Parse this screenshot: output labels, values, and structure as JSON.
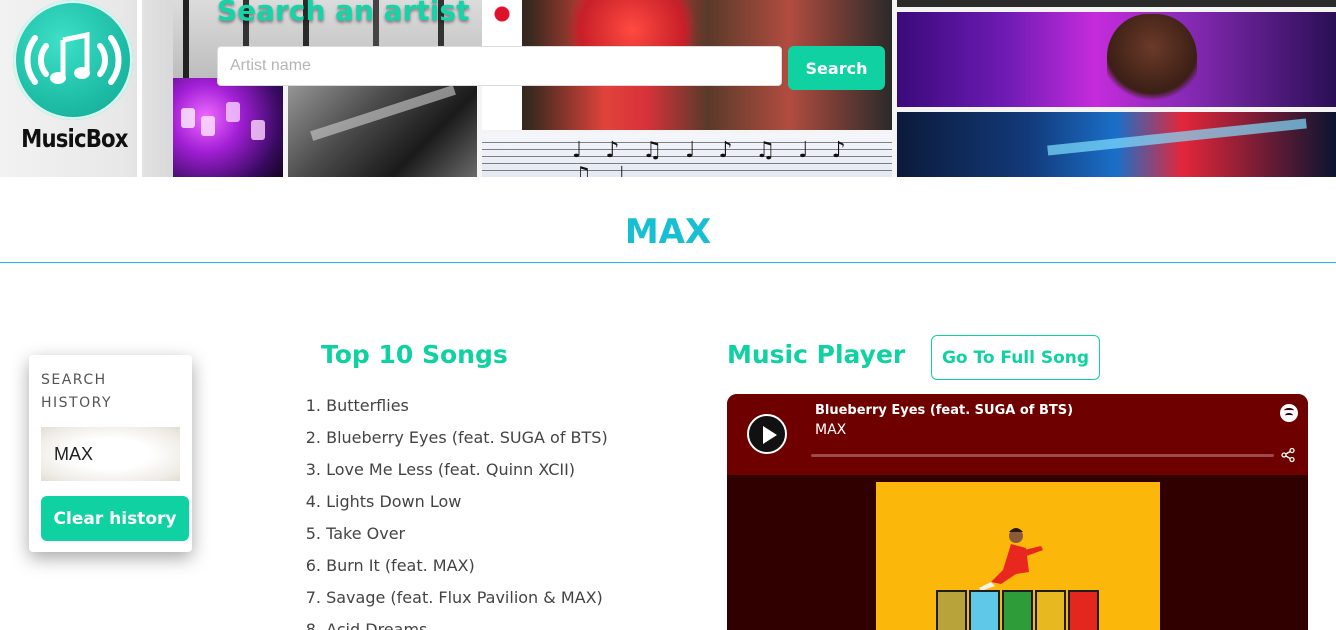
{
  "brand": {
    "name": "MusicBox",
    "accent_color": "#10d1a2",
    "title_color": "#17bfd2"
  },
  "header": {
    "search_title": "Search an artist",
    "search_placeholder": "Artist name",
    "search_value": "",
    "search_button_label": "Search"
  },
  "artist": {
    "name": "MAX"
  },
  "search_history": {
    "heading": "SEARCH HISTORY",
    "items": [
      "MAX"
    ],
    "clear_button_label": "Clear history"
  },
  "top_songs": {
    "heading": "Top 10 Songs",
    "songs": [
      "Butterflies",
      "Blueberry Eyes (feat. SUGA of BTS)",
      "Love Me Less (feat. Quinn XCII)",
      "Lights Down Low",
      "Take Over",
      "Burn It (feat. MAX)",
      "Savage (feat. Flux Pavilion & MAX)",
      "Acid Dreams"
    ]
  },
  "music_player": {
    "heading": "Music Player",
    "full_song_button_label": "Go To Full Song",
    "track_title": "Blueberry Eyes (feat. SUGA of BTS)",
    "track_artist": "MAX",
    "progress": 0,
    "icons": {
      "play": "play-icon",
      "spotify": "spotify-icon",
      "share": "share-icon"
    },
    "colors": {
      "player_top": "#6e0000",
      "player_bg": "#300000",
      "album_bg": "#fbb70a"
    }
  }
}
